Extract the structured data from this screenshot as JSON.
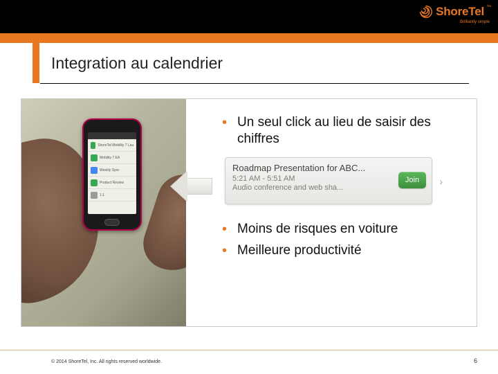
{
  "brand": {
    "name": "ShoreTel",
    "tagline": "Brilliantly simple",
    "accent_color": "#e87722"
  },
  "slide": {
    "title": "Integration au calendrier",
    "bullets_a": [
      "Un seul click au lieu de saisir des chiffres"
    ],
    "bullets_b": [
      "Moins de risques en voiture",
      "Meilleure productivité"
    ]
  },
  "calendar_card": {
    "title": "Roadmap Presentation for ABC...",
    "time": "5:21 AM - 5:51 AM",
    "subtitle": "Audio conference and web sha...",
    "join_label": "Join"
  },
  "footer": {
    "copyright": "© 2014 ShoreTel, Inc. All rights reserved worldwide.",
    "page_number": "6"
  }
}
